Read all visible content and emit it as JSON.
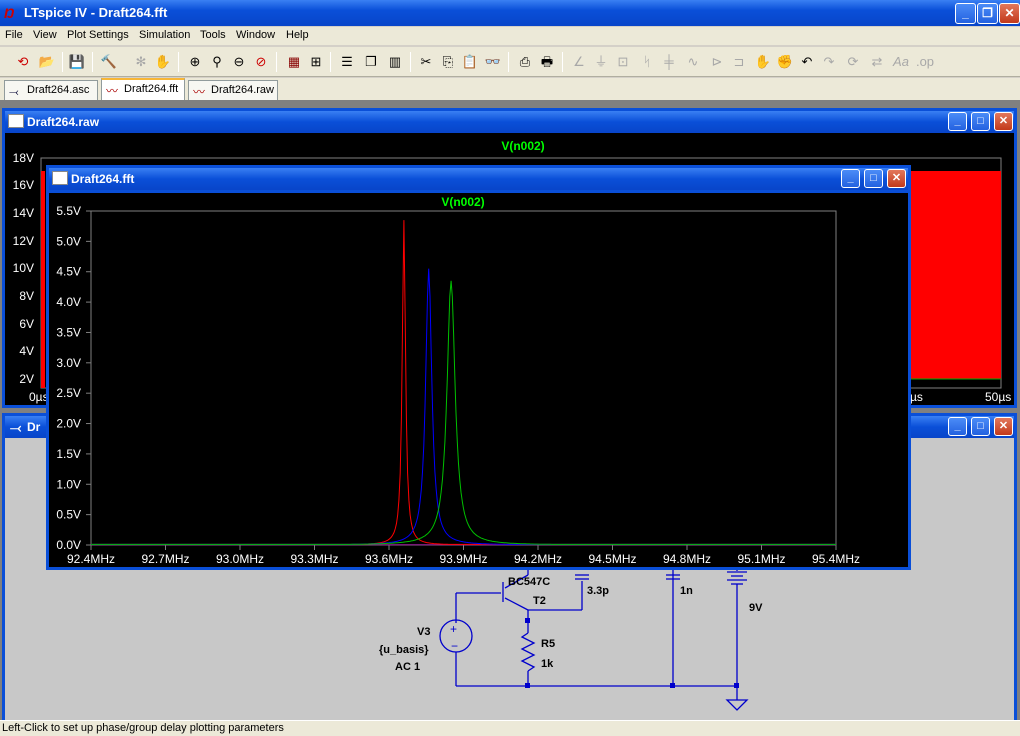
{
  "app": {
    "title": "LTspice IV - Draft264.fft"
  },
  "menu": [
    "File",
    "View",
    "Plot Settings",
    "Simulation",
    "Tools",
    "Window",
    "Help"
  ],
  "tabs": [
    {
      "label": "Draft264.asc",
      "icon": "schematic-icon"
    },
    {
      "label": "Draft264.fft",
      "icon": "waveform-icon"
    },
    {
      "label": "Draft264.raw",
      "icon": "waveform-icon"
    }
  ],
  "raw_window": {
    "title": "Draft264.raw",
    "trace_label": "V(n002)",
    "y_ticks": [
      "18V",
      "16V",
      "14V",
      "12V",
      "10V",
      "8V",
      "6V",
      "4V",
      "2V"
    ],
    "x_first": "0µs",
    "x_mid_fragment": "µs",
    "x_last": "50µs"
  },
  "schematic_window": {
    "title_fragment": "Dr"
  },
  "fft_window": {
    "title": "Draft264.fft",
    "trace_label": "V(n002)",
    "y_ticks": [
      "5.5V",
      "5.0V",
      "4.5V",
      "4.0V",
      "3.5V",
      "3.0V",
      "2.5V",
      "2.0V",
      "1.5V",
      "1.0V",
      "0.5V",
      "0.0V"
    ],
    "x_ticks": [
      "92.4MHz",
      "92.7MHz",
      "93.0MHz",
      "93.3MHz",
      "93.6MHz",
      "93.9MHz",
      "94.2MHz",
      "94.5MHz",
      "94.8MHz",
      "95.1MHz",
      "95.4MHz"
    ]
  },
  "chart_data": {
    "type": "line",
    "title": "V(n002)",
    "xlabel": "",
    "ylabel": "",
    "xlim": [
      92.4,
      95.4
    ],
    "ylim": [
      0.0,
      5.5
    ],
    "x_unit": "MHz",
    "y_unit": "V",
    "grid": false,
    "series": [
      {
        "color": "#ff0000",
        "peak_x": 93.66,
        "peak_y": 5.35
      },
      {
        "color": "#0000ff",
        "peak_x": 93.76,
        "peak_y": 4.55
      },
      {
        "color": "#00c000",
        "peak_x": 93.85,
        "peak_y": 4.35
      }
    ]
  },
  "schematic": {
    "transistor": {
      "model": "BC547C",
      "ref": "T2"
    },
    "cap1": "3.3p",
    "cap2": "1n",
    "battery": "9V",
    "resistor": {
      "ref": "R5",
      "value": "1k"
    },
    "source": {
      "ref": "V3",
      "value": "{u_basis}",
      "ac": "AC 1"
    }
  },
  "colors": {
    "trace_label": "#00ff00",
    "plot_bg": "#000000",
    "raw_fill": "#ff0000"
  },
  "status": "Left-Click to set up phase/group delay plotting parameters"
}
